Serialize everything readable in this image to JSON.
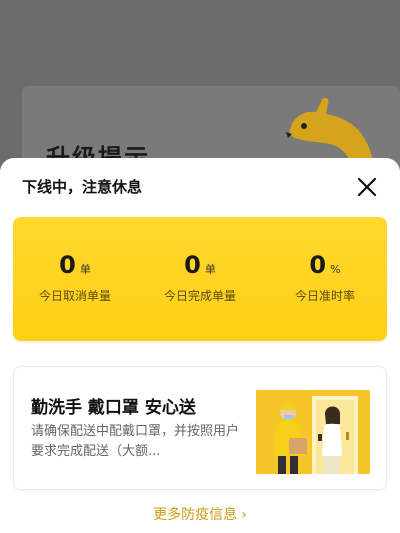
{
  "background": {
    "title": "升级提示"
  },
  "sheet": {
    "title": "下线中，注意休息"
  },
  "stats": [
    {
      "value": "0",
      "unit": "单",
      "label": "今日取消单量"
    },
    {
      "value": "0",
      "unit": "单",
      "label": "今日完成单量"
    },
    {
      "value": "0",
      "unit": "%",
      "label": "今日准时率"
    }
  ],
  "info_card": {
    "title": "勤洗手 戴口罩 安心送",
    "description": "请确保配送中配戴口罩，并按照用户要求完成配送（大额..."
  },
  "more_link": {
    "label": "更多防疫信息",
    "chevron": "›"
  },
  "icons": {
    "close": "close-icon",
    "mascot": "kangaroo-mascot-icon",
    "chevron": "chevron-right-icon"
  },
  "colors": {
    "accent": "#ffd21f",
    "link": "#c99b14"
  }
}
